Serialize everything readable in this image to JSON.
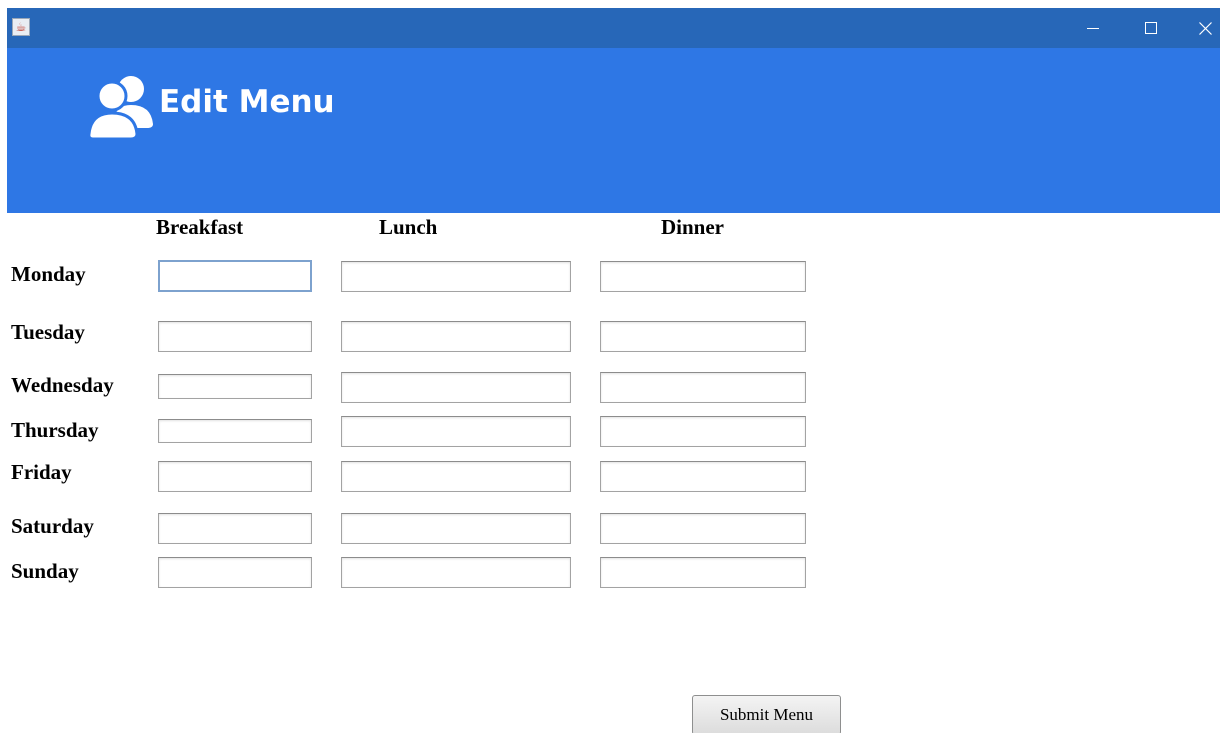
{
  "window": {
    "title": "",
    "icon": "java-cup-icon",
    "controls": [
      "minimize",
      "maximize",
      "close"
    ]
  },
  "banner": {
    "title": "Edit Menu",
    "icon": "users-icon",
    "color": "#2e77e5"
  },
  "columns": {
    "breakfast": "Breakfast",
    "lunch": "Lunch",
    "dinner": "Dinner"
  },
  "days": [
    {
      "label": "Monday",
      "breakfast": "",
      "lunch": "",
      "dinner": ""
    },
    {
      "label": "Tuesday",
      "breakfast": "",
      "lunch": "",
      "dinner": ""
    },
    {
      "label": "Wednesday",
      "breakfast": "",
      "lunch": "",
      "dinner": ""
    },
    {
      "label": "Thursday",
      "breakfast": "",
      "lunch": "",
      "dinner": ""
    },
    {
      "label": "Friday",
      "breakfast": "",
      "lunch": "",
      "dinner": ""
    },
    {
      "label": "Saturday",
      "breakfast": "",
      "lunch": "",
      "dinner": ""
    },
    {
      "label": "Sunday",
      "breakfast": "",
      "lunch": "",
      "dinner": ""
    }
  ],
  "focused_field": "monday-breakfast",
  "submit": {
    "label": "Submit Menu"
  },
  "colors": {
    "titlebar": "#2767b8",
    "banner": "#2e77e5"
  }
}
